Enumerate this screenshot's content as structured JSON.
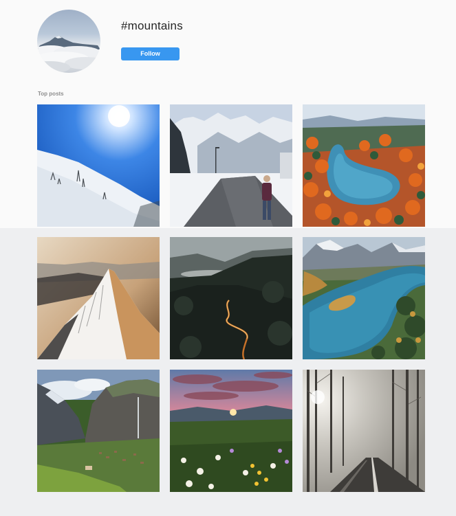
{
  "header": {
    "hashtag": "#mountains",
    "follow_label": "Follow",
    "accent_color": "#3897f0"
  },
  "section": {
    "top_posts_label": "Top posts"
  },
  "posts": [
    {
      "scene": "snowy-slope-blue-sky"
    },
    {
      "scene": "snowy-road-hiker"
    },
    {
      "scene": "autumn-lake-aerial"
    },
    {
      "scene": "sunlit-snow-ridge"
    },
    {
      "scene": "dark-forest-winding-road"
    },
    {
      "scene": "turquoise-lake-valley"
    },
    {
      "scene": "cliff-valley-waterfall"
    },
    {
      "scene": "sunset-wildflower-meadow"
    },
    {
      "scene": "foggy-forest-road"
    }
  ]
}
